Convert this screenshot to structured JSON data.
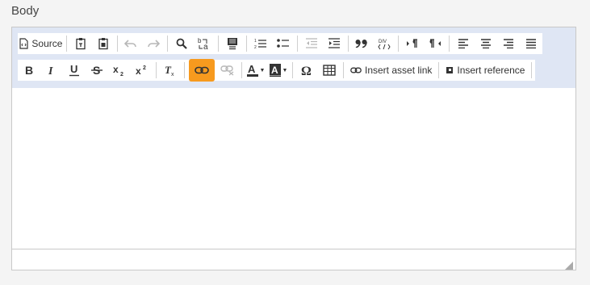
{
  "field": {
    "label": "Body"
  },
  "toolbar": {
    "row1": {
      "source_label": "Source"
    },
    "row2": {
      "insert_asset_link_label": "Insert asset link",
      "insert_reference_label": "Insert reference"
    }
  },
  "colors": {
    "active_button": "#f79a1e",
    "toolbar_bg": "#dfe6f4"
  },
  "icons": [
    "source-icon",
    "paste-text-icon",
    "paste-word-icon",
    "undo-icon",
    "redo-icon",
    "find-icon",
    "replace-icon",
    "select-all-icon",
    "numbered-list-icon",
    "bulleted-list-icon",
    "decrease-indent-icon",
    "increase-indent-icon",
    "blockquote-icon",
    "div-container-icon",
    "ltr-icon",
    "rtl-icon",
    "align-left-icon",
    "align-center-icon",
    "align-right-icon",
    "justify-icon",
    "bold-icon",
    "italic-icon",
    "underline-icon",
    "strikethrough-icon",
    "subscript-icon",
    "superscript-icon",
    "remove-format-icon",
    "link-icon",
    "unlink-icon",
    "text-color-icon",
    "background-color-icon",
    "special-char-icon",
    "table-icon",
    "asset-link-icon",
    "reference-icon",
    "resize-grip-icon"
  ]
}
